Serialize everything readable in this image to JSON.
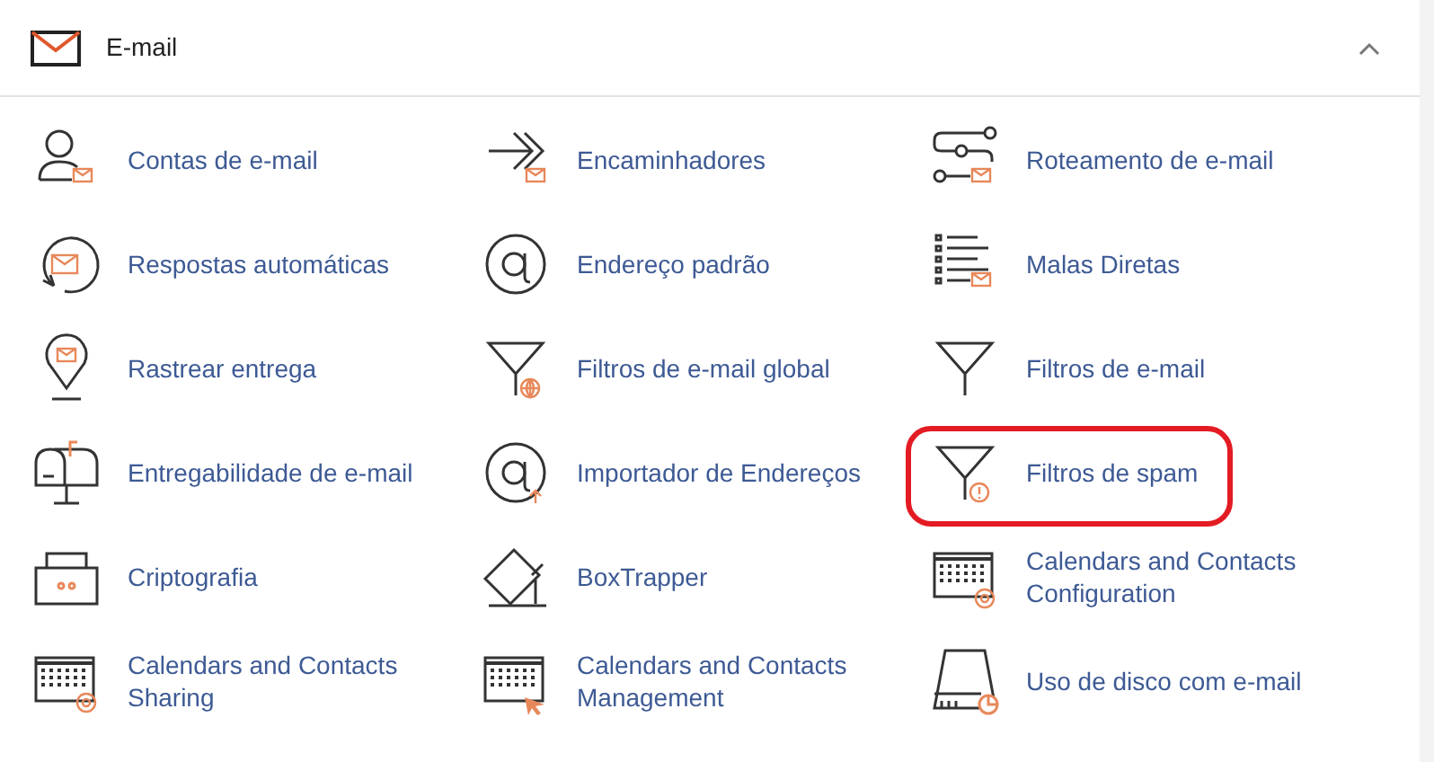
{
  "section": {
    "title": "E-mail",
    "expanded": true
  },
  "rows": [
    [
      {
        "label": "Contas de e-mail",
        "highlighted": false
      },
      {
        "label": "Encaminhadores",
        "highlighted": false
      },
      {
        "label": "Roteamento de e-mail",
        "highlighted": false
      }
    ],
    [
      {
        "label": "Respostas automáticas",
        "highlighted": false
      },
      {
        "label": "Endereço padrão",
        "highlighted": false
      },
      {
        "label": "Malas Diretas",
        "highlighted": false
      }
    ],
    [
      {
        "label": "Rastrear entrega",
        "highlighted": false
      },
      {
        "label": "Filtros de e-mail global",
        "highlighted": false
      },
      {
        "label": "Filtros de e-mail",
        "highlighted": false
      }
    ],
    [
      {
        "label": "Entregabilidade de e-mail",
        "highlighted": false
      },
      {
        "label": "Importador de Endereços",
        "highlighted": false
      },
      {
        "label": "Filtros de spam",
        "highlighted": true
      }
    ],
    [
      {
        "label": "Criptografia",
        "highlighted": false
      },
      {
        "label": "BoxTrapper",
        "highlighted": false
      },
      {
        "label": "Calendars and Contacts Configuration",
        "highlighted": false
      }
    ],
    [
      {
        "label": "Calendars and Contacts Sharing",
        "highlighted": false
      },
      {
        "label": "Calendars and Contacts Management",
        "highlighted": false
      },
      {
        "label": "Uso de disco com e-mail",
        "highlighted": false
      }
    ]
  ]
}
